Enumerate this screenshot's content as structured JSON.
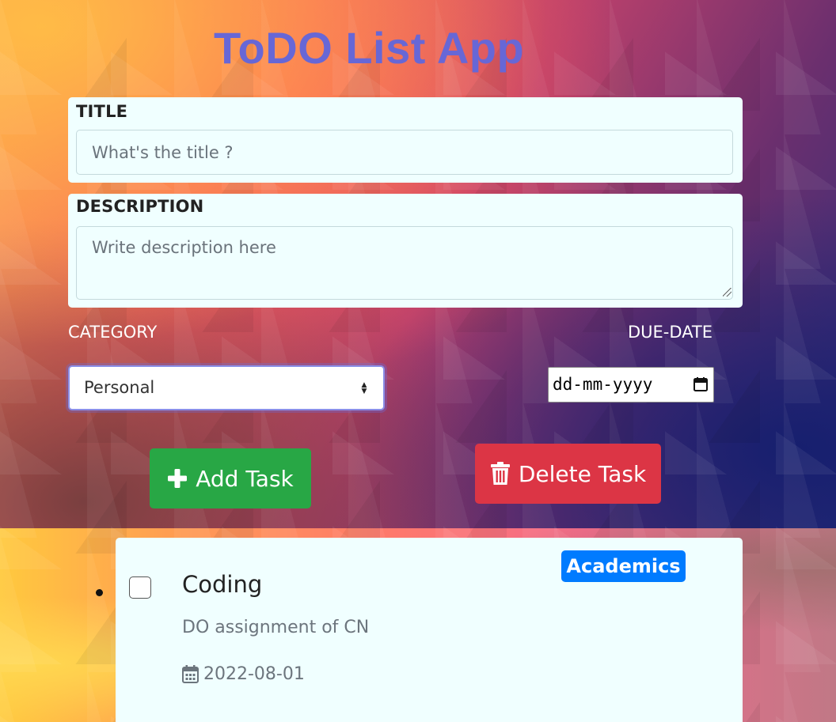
{
  "app": {
    "title": "ToDO List App"
  },
  "form": {
    "title_label": "TITLE",
    "title_placeholder": "What's the title ?",
    "description_label": "DESCRIPTION",
    "description_placeholder": "Write description here",
    "category_label": "CATEGORY",
    "category_selected": "Personal",
    "due_date_label": "DUE-DATE",
    "due_date_placeholder": "dd-mm-yyyy"
  },
  "buttons": {
    "add_label": "Add Task",
    "add_icon": "plus-icon",
    "delete_label": "Delete Task",
    "delete_icon": "trash-icon",
    "add_color": "#28a745",
    "delete_color": "#dc3545"
  },
  "tasks": [
    {
      "title": "Coding",
      "description": "DO assignment of CN",
      "date": "2022-08-01",
      "category": "Academics",
      "category_color": "#007bff",
      "checked": false,
      "icon": "calendar-icon"
    }
  ],
  "colors": {
    "title": "#6767d6",
    "panel_bg": "#f0ffff"
  }
}
